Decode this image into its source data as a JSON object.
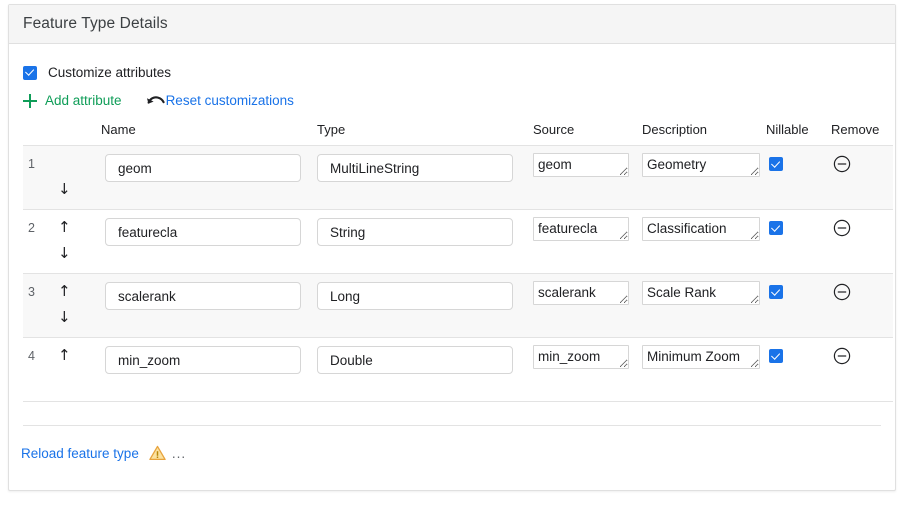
{
  "panel": {
    "title": "Feature Type Details"
  },
  "customize": {
    "label": "Customize attributes",
    "checked": true
  },
  "actions": {
    "add_attribute_label": "Add attribute",
    "add_attribute_icon": "plus-icon",
    "reset_label": "Reset customizations",
    "reset_icon": "undo-arrow-icon"
  },
  "table": {
    "columns": {
      "name": "Name",
      "type": "Type",
      "source": "Source",
      "description": "Description",
      "nillable": "Nillable",
      "remove": "Remove"
    },
    "rows": [
      {
        "index": "1",
        "name": "geom",
        "type": "MultiLineString",
        "source": "geom",
        "description": "Geometry",
        "nillable": true,
        "move_up": false,
        "move_down": true,
        "remove_icon": "minus-circle-icon"
      },
      {
        "index": "2",
        "name": "featurecla",
        "type": "String",
        "source": "featurecla",
        "description": "Classification",
        "nillable": true,
        "move_up": true,
        "move_down": true,
        "remove_icon": "minus-circle-icon"
      },
      {
        "index": "3",
        "name": "scalerank",
        "type": "Long",
        "source": "scalerank",
        "description": "Scale Rank",
        "nillable": true,
        "move_up": true,
        "move_down": true,
        "remove_icon": "minus-circle-icon"
      },
      {
        "index": "4",
        "name": "min_zoom",
        "type": "Double",
        "source": "min_zoom",
        "description": "Minimum Zoom",
        "nillable": true,
        "move_up": true,
        "move_down": false,
        "remove_icon": "minus-circle-icon"
      }
    ],
    "arrow_up_glyph": "↑",
    "arrow_down_glyph": "↓"
  },
  "footer": {
    "reload_label": "Reload feature type",
    "warning_icon": "warning-triangle-icon",
    "ellipsis": "..."
  },
  "colors": {
    "accent_blue": "#1a73e8",
    "accent_green": "#0f9d58",
    "warning_amber": "#f4b400",
    "header_bg": "#f5f5f5",
    "row_stripe": "#f8f8f8",
    "border": "#e3e3e3"
  }
}
